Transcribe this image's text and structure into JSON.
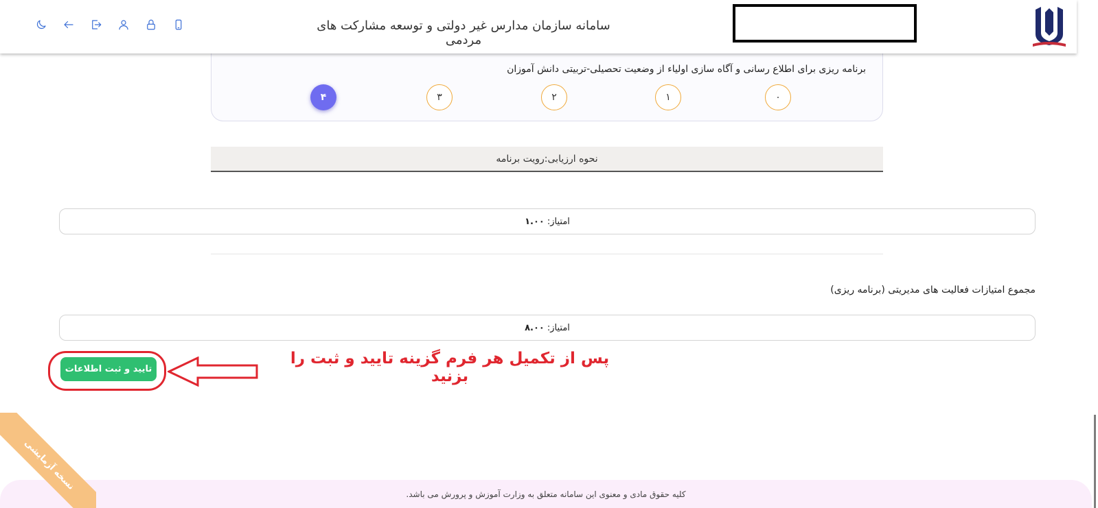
{
  "header": {
    "title": "سامانه سازمان مدارس غیر دولتی و توسعه مشارکت های مردمی",
    "icons": [
      "moon-icon",
      "back-arrow-icon",
      "logout-icon",
      "user-icon",
      "lock-icon",
      "mobile-icon"
    ]
  },
  "question": {
    "text": "برنامه ریزی برای اطلاع رسانی و آگاه سازی اولیاء از وضعیت تحصیلی-تربیتی دانش آموزان",
    "options": [
      "۰",
      "۱",
      "۲",
      "۳",
      "۴"
    ],
    "selected": "۴"
  },
  "evaluation": {
    "label": "نحوه ارزیابی:رویت برنامه"
  },
  "item_score": {
    "label": "امتیاز:",
    "value": "۱.۰۰"
  },
  "total": {
    "label": "مجموع امتیازات فعالیت های مدیریتی (برنامه ریزی)",
    "score_label": "امتیاز:",
    "score_value": "۸.۰۰"
  },
  "actions": {
    "confirm_label": "تایید و ثبت اطلاعات"
  },
  "annotation": {
    "instruction": "پس از تکمیل هر فرم گزینه تایید و ثبت را بزنید",
    "color": "#e0262f"
  },
  "footer": {
    "text": "کلیه حقوق مادی و معنوی این سامانه متعلق به وزارت آموزش و پرورش می باشد."
  },
  "ribbon": {
    "text": "نسخه آزمایشی"
  },
  "colors": {
    "accent": "#3b6fd6",
    "selected": "#6f6cf0",
    "option_border": "#f0a93a",
    "confirm": "#2fbf71"
  }
}
